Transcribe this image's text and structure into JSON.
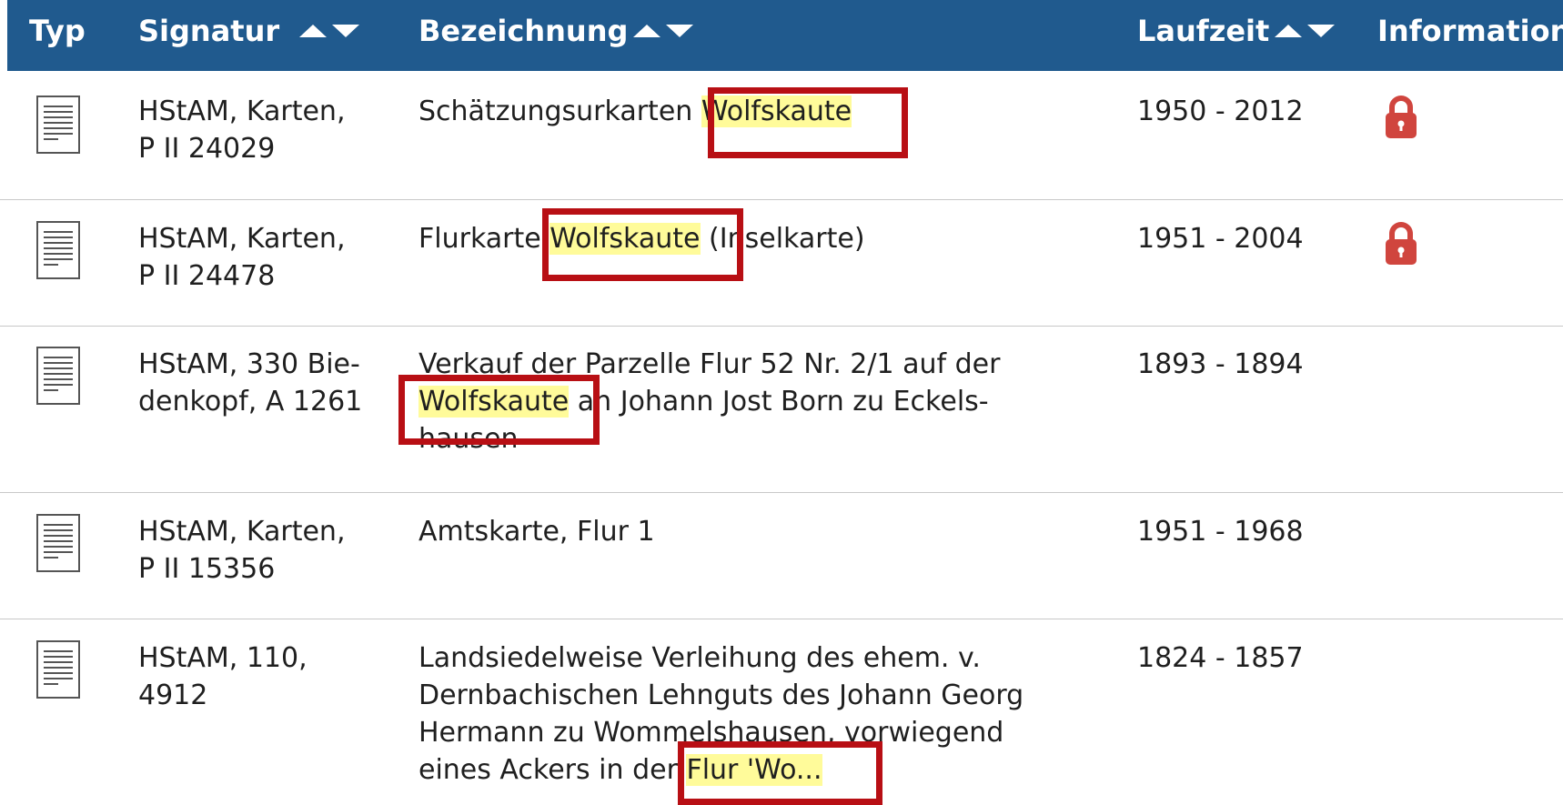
{
  "table": {
    "columns": {
      "typ": "Typ",
      "signatur": "Signatur",
      "bezeichnung": "Bezeichnung",
      "laufzeit": "Laufzeit",
      "information": "Information"
    },
    "rows": [
      {
        "signatur_line1": "HStAM, Karten,",
        "signatur_line2": "P II 24029",
        "bez_before": "Schätzungsurkarten ",
        "bez_hl": "Wolfskaute",
        "bez_after": "",
        "laufzeit": "1950 - 2012",
        "locked": true
      },
      {
        "signatur_line1": "HStAM, Karten,",
        "signatur_line2": "P II 24478",
        "bez_before": "Flurkarte ",
        "bez_hl": "Wolfskaute",
        "bez_after": " (Inselkarte)",
        "laufzeit": "1951 - 2004",
        "locked": true
      },
      {
        "signatur_line1": "HStAM, 330 Bie-",
        "signatur_line2": "denkopf, A 1261",
        "bez_line1": "Verkauf der Parzelle Flur 52 Nr. 2/1 auf der",
        "bez_hl": "Wolfskaute",
        "bez_after": " an Johann Jost Born zu Eckels-",
        "bez_line3": "hausen",
        "laufzeit": "1893 - 1894",
        "locked": false
      },
      {
        "signatur_line1": "HStAM, Karten,",
        "signatur_line2": "P II 15356",
        "bez_before": "Amtskarte, Flur 1",
        "laufzeit": "1951 - 1968",
        "locked": false
      },
      {
        "signatur_line1": "HStAM, 110,",
        "signatur_line2": "4912",
        "bez_line1": "Landsiedelweise Verleihung des ehem. v.",
        "bez_line2": "Dernbachischen Lehnguts des Johann Georg",
        "bez_line3": "Hermann zu Wommelshausen, vorwiegend",
        "bez_line4_before": "eines Ackers in der ",
        "bez_hl": "Flur 'Wo...",
        "laufzeit": "1824 - 1857",
        "locked": false
      }
    ]
  },
  "colors": {
    "header_bg": "#205a8e",
    "highlight": "#fffb9a",
    "annotation_box": "#b80f14",
    "lock": "#d0453e"
  },
  "icons": [
    "document-icon",
    "lock-icon",
    "sort-arrows-icon"
  ]
}
